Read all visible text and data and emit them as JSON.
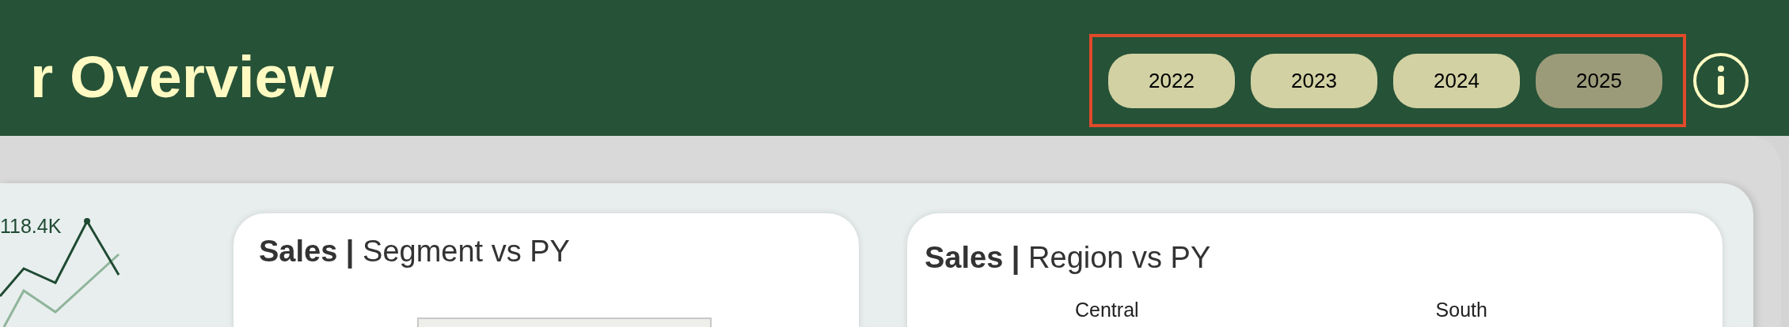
{
  "header": {
    "title": "r Overview",
    "year_filter": [
      {
        "label": "2022",
        "selected": false
      },
      {
        "label": "2023",
        "selected": false
      },
      {
        "label": "2024",
        "selected": false
      },
      {
        "label": "2025",
        "selected": true
      }
    ]
  },
  "trend": {
    "label": "118.4K"
  },
  "cards": [
    {
      "kind": "segment",
      "title": "**Sales |** Segment vs PY"
    },
    {
      "kind": "region",
      "title": "**Sales |** Region vs PY",
      "labels": [
        "Central",
        "South"
      ]
    }
  ]
}
